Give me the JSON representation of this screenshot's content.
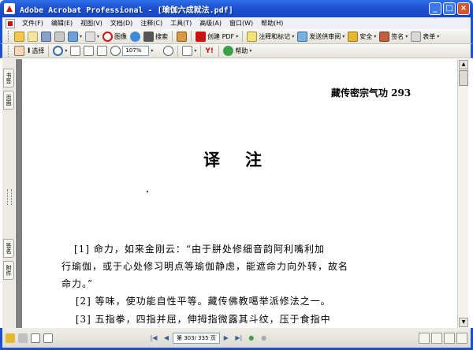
{
  "window": {
    "title": "Adobe Acrobat Professional - [瑜伽六成就法.pdf]",
    "controls": {
      "minimize": "_",
      "maximize": "□",
      "close": "×"
    }
  },
  "menubar": {
    "items": [
      {
        "label": "文件(F)"
      },
      {
        "label": "编辑(E)"
      },
      {
        "label": "视图(V)"
      },
      {
        "label": "文档(D)"
      },
      {
        "label": "注释(C)"
      },
      {
        "label": "工具(T)"
      },
      {
        "label": "高级(A)"
      },
      {
        "label": "窗口(W)"
      },
      {
        "label": "帮助(H)"
      }
    ]
  },
  "toolbar1": {
    "image_label": "图像",
    "search_label": "搜索",
    "create_pdf_label": "创建 PDF",
    "comment_label": "注释和标记",
    "review_label": "发送供审阅",
    "security_label": "安全",
    "sign_label": "签名",
    "forms_label": "表单"
  },
  "toolbar2": {
    "select_label": "选择",
    "zoom_value": "107%",
    "help_label": "帮助"
  },
  "navpanel": {
    "tabs": [
      "书签",
      "页面",
      "签名",
      "附件"
    ]
  },
  "document": {
    "header": "藏传密宗气功 293",
    "heading": "译注",
    "paragraphs": [
      "[1] 命力，如来金刚云：“由于胼处修细音韵阿利嘴利加",
      "行瑜伽，或于心处修习明点等瑜伽静虑，能遮命力向外转，故名",
      "命力。”",
      "　 [2] 等味，使功能自性平等。藏传佛教噶举派修法之一。",
      "　 [3] 五指拳，四指并屈，伸拇指微露其斗纹，压于食指中"
    ]
  },
  "statusbar": {
    "page_display": "第 303/ 335 页"
  },
  "colors": {
    "titlebar": "#1c4fcf",
    "accent_red": "#cc1111"
  }
}
